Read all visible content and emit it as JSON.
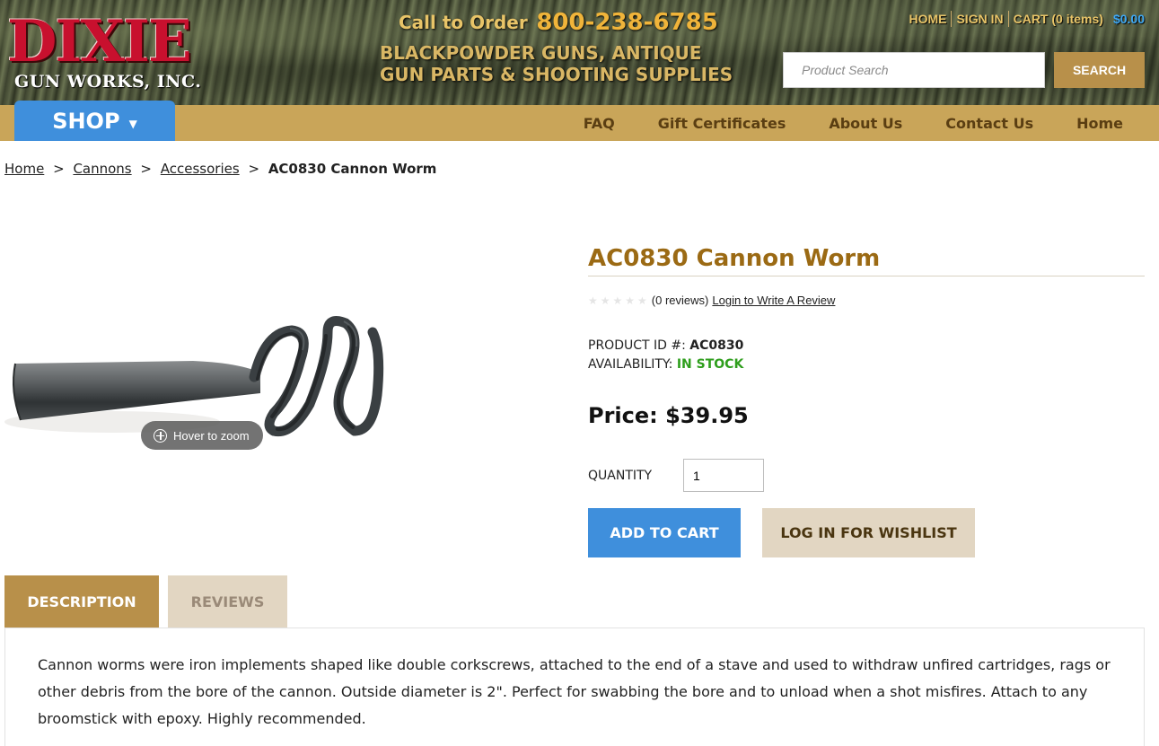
{
  "brand": {
    "logo_main": "DIXIE",
    "logo_sub": "GUN WORKS, INC.",
    "call_label": "Call to Order",
    "phone": "800-238-6785",
    "tagline_line1": "BLACKPOWDER GUNS, ANTIQUE",
    "tagline_line2": "GUN PARTS & SHOOTING SUPPLIES"
  },
  "top_links": {
    "home": "HOME",
    "sign_in": "SIGN IN",
    "cart": "CART (0 items)",
    "cart_total": "$0.00"
  },
  "search": {
    "placeholder": "Product Search",
    "button_label": "SEARCH"
  },
  "nav": {
    "shop_label": "SHOP",
    "items": [
      {
        "label": "FAQ"
      },
      {
        "label": "Gift Certificates"
      },
      {
        "label": "About Us"
      },
      {
        "label": "Contact Us"
      },
      {
        "label": "Home"
      }
    ]
  },
  "breadcrumb": {
    "items": [
      "Home",
      "Cannons",
      "Accessories"
    ],
    "separator": ">",
    "current": "AC0830 Cannon Worm"
  },
  "product": {
    "image_zoom_hint": "Hover to zoom",
    "title": "AC0830 Cannon Worm",
    "stars": "★★★★★",
    "review_count": "(0 reviews)",
    "write_review": "Login to Write A Review",
    "id_label": "PRODUCT ID #:",
    "id_value": "AC0830",
    "availability_label": "AVAILABILITY:",
    "availability_value": "IN STOCK",
    "price": "Price: $39.95",
    "quantity_label": "QUANTITY",
    "quantity_value": "1",
    "add_to_cart": "ADD TO CART",
    "wishlist": "LOG IN FOR WISHLIST"
  },
  "tabs": {
    "description": "DESCRIPTION",
    "reviews": "REVIEWS",
    "description_text": "Cannon worms were iron implements shaped like double corkscrews, attached to the end of a stave and used to withdraw unfired cartridges, rags or other debris from the bore of the cannon. Outside diameter is 2\". Perfect for swabbing the bore and to unload when a shot misfires. Attach to any broomstick with epoxy. Highly recommended."
  },
  "colors": {
    "header_gold": "#e8c468",
    "nav_bar": "#c9a559",
    "shop_blue": "#3f8fdc",
    "title_brown": "#9b6a14",
    "in_stock_green": "#2e9e1c",
    "logo_red": "#c8102e"
  }
}
